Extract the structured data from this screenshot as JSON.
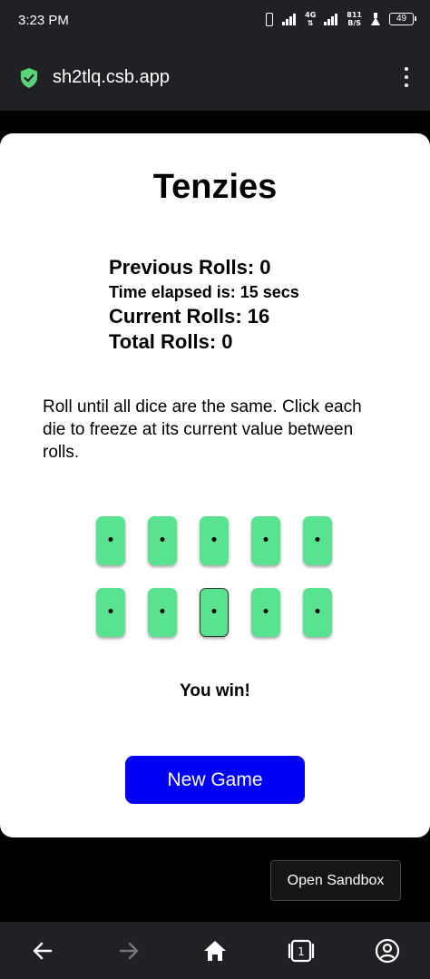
{
  "status_bar": {
    "time": "3:23 PM",
    "network_label": "4G",
    "speed_value": "811",
    "speed_unit": "B/S",
    "battery": "49"
  },
  "browser": {
    "url": "sh2tlq.csb.app",
    "lock_color": "#5bd37a"
  },
  "game": {
    "title": "Tenzies",
    "stats": {
      "previous_rolls": "Previous Rolls: 0",
      "time_elapsed": "Time elapsed is: 15 secs",
      "current_rolls": "Current Rolls: 16",
      "total_rolls": "Total Rolls: 0"
    },
    "instructions": "Roll until all dice are the same. Click each die to freeze at its current value between rolls.",
    "dice": [
      {
        "value": "•",
        "held": false
      },
      {
        "value": "•",
        "held": false
      },
      {
        "value": "•",
        "held": false
      },
      {
        "value": "•",
        "held": false
      },
      {
        "value": "•",
        "held": false
      },
      {
        "value": "•",
        "held": false
      },
      {
        "value": "•",
        "held": false
      },
      {
        "value": "•",
        "held": true
      },
      {
        "value": "•",
        "held": false
      },
      {
        "value": "•",
        "held": false
      }
    ],
    "die_color": "#59e391",
    "win_message": "You win!",
    "new_game_label": "New Game",
    "button_color": "#0000f5"
  },
  "sandbox": {
    "open_label": "Open Sandbox"
  },
  "bottom_nav": {
    "icons": [
      "back-icon",
      "forward-icon",
      "home-icon",
      "tabs-icon",
      "account-icon"
    ],
    "tab_count": "1"
  }
}
